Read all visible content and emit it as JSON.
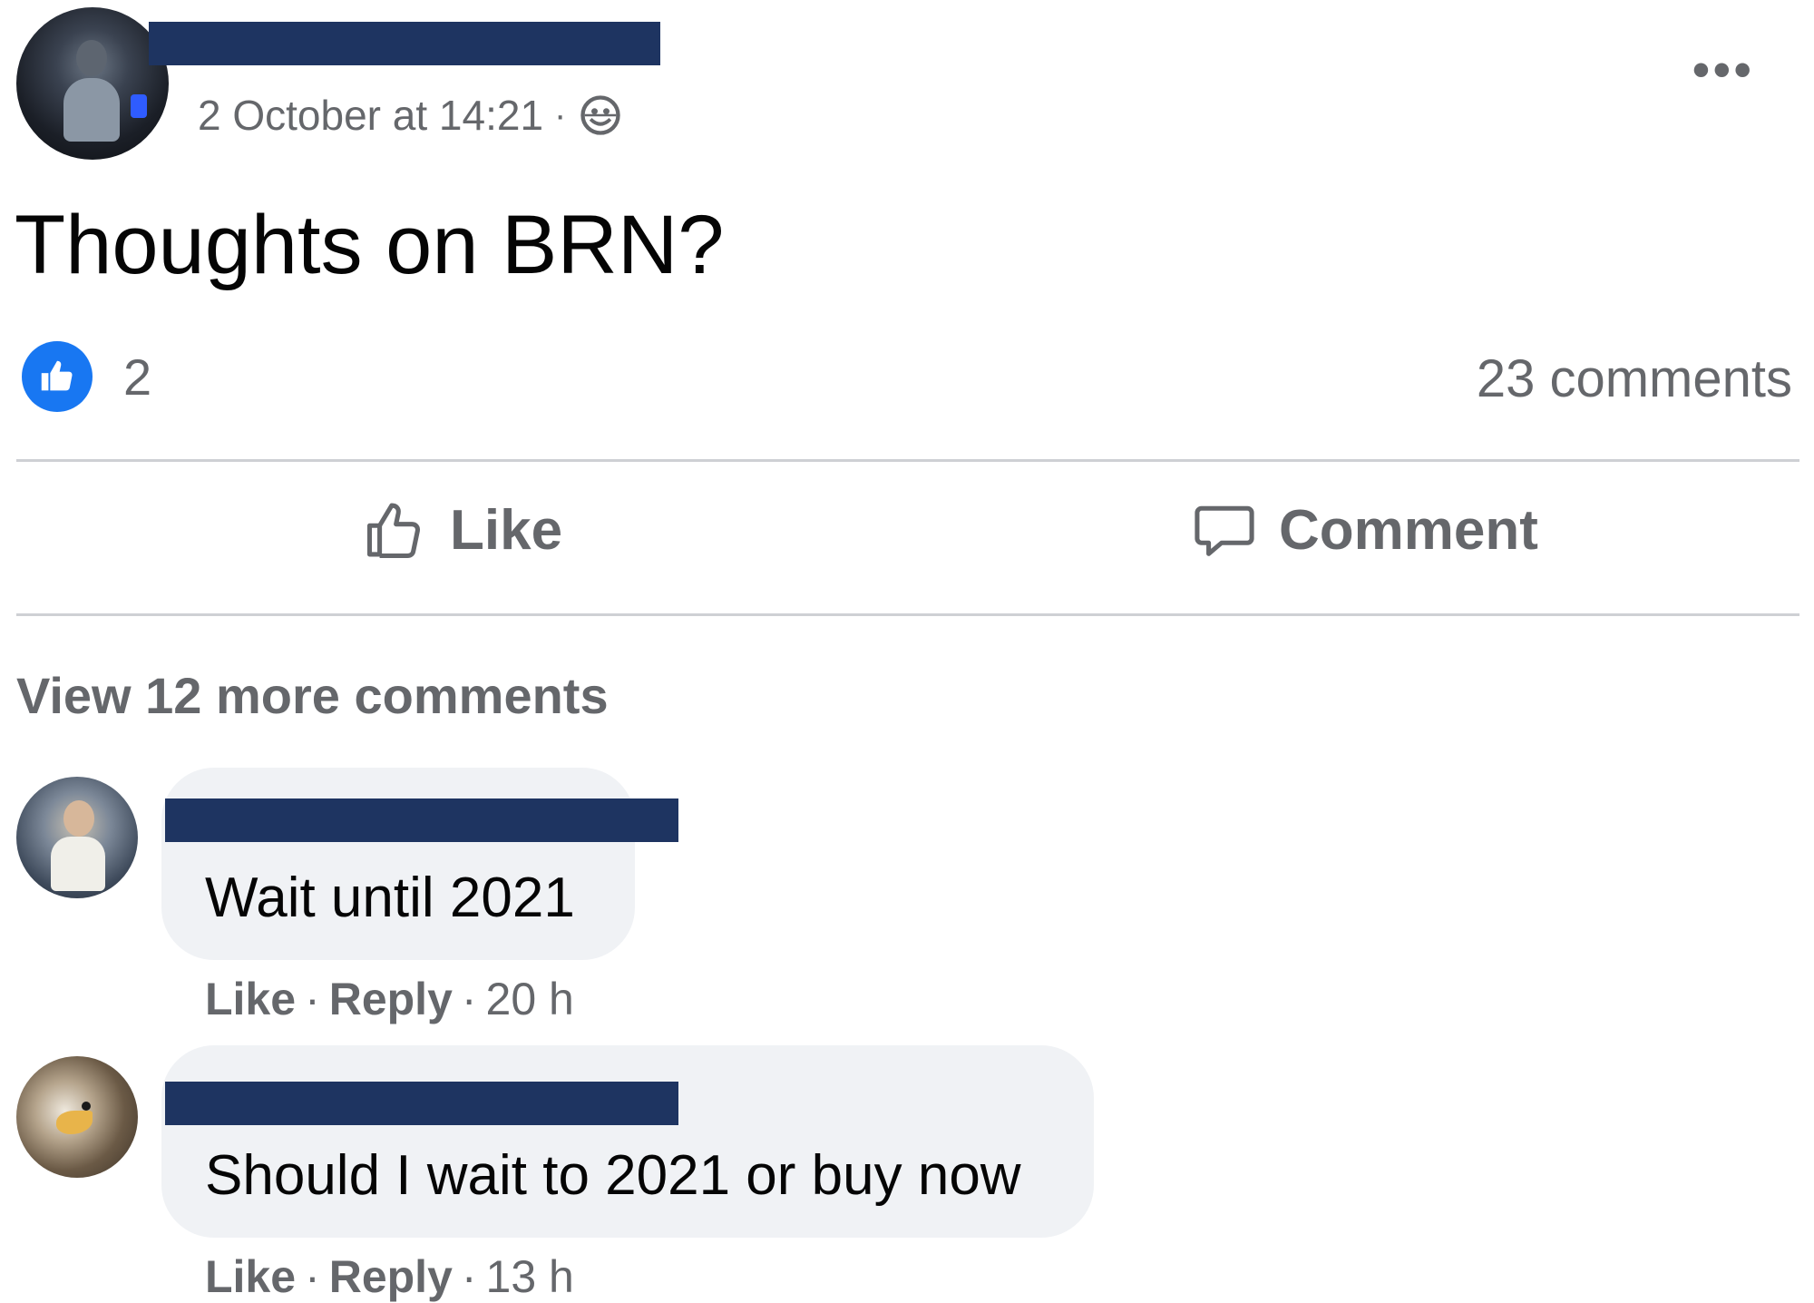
{
  "post": {
    "timestamp": "2 October at 14:21",
    "separator": "·",
    "text": "Thoughts on BRN?",
    "more_label": "•••"
  },
  "reactions": {
    "count": "2",
    "comments": "23 comments"
  },
  "actions": {
    "like": "Like",
    "comment": "Comment"
  },
  "view_more": "View 12 more comments",
  "comments": [
    {
      "text": "Wait until 2021",
      "like": "Like",
      "reply": "Reply",
      "sep": "·",
      "time": "20 h"
    },
    {
      "text": "Should I wait to 2021 or buy now",
      "like": "Like",
      "reply": "Reply",
      "sep": "·",
      "time": "13 h"
    }
  ],
  "colors": {
    "redaction": "#1e3461",
    "accent": "#1877f2",
    "secondary_text": "#65676b",
    "bubble": "#f0f2f5"
  }
}
